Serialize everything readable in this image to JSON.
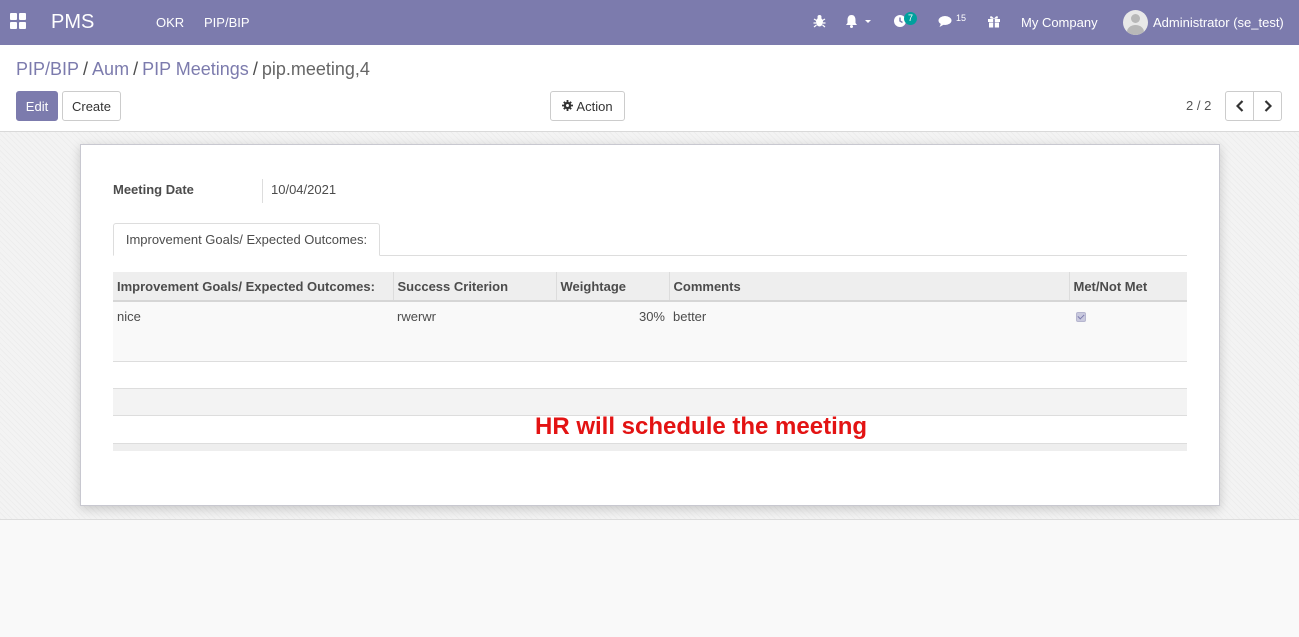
{
  "navbar": {
    "brand": "PMS",
    "menu": [
      "OKR",
      "PIP/BIP"
    ],
    "activity_count": "7",
    "messages_count": "15",
    "company": "My Company",
    "user": "Administrator (se_test)"
  },
  "breadcrumb": {
    "items": [
      "PIP/BIP",
      "Aum",
      "PIP Meetings"
    ],
    "current": "pip.meeting,4",
    "separator": "/"
  },
  "toolbar": {
    "edit_label": "Edit",
    "create_label": "Create",
    "action_label": "Action"
  },
  "pager": {
    "text": "2 / 2"
  },
  "form": {
    "meeting_date_label": "Meeting Date",
    "meeting_date_value": "10/04/2021",
    "tab_label": "Improvement Goals/ Expected Outcomes:"
  },
  "table": {
    "headers": [
      "Improvement Goals/ Expected Outcomes:",
      "Success Criterion",
      "Weightage",
      "Comments",
      "Met/Not Met"
    ],
    "rows": [
      {
        "goal": "nice",
        "criterion": "rwerwr",
        "weightage": "30%",
        "comments": "better",
        "met": true
      }
    ]
  },
  "annotation": "HR will schedule the meeting",
  "colors": {
    "accent": "#7c7bad",
    "annotation": "#e31313",
    "badge": "#00a09d"
  }
}
